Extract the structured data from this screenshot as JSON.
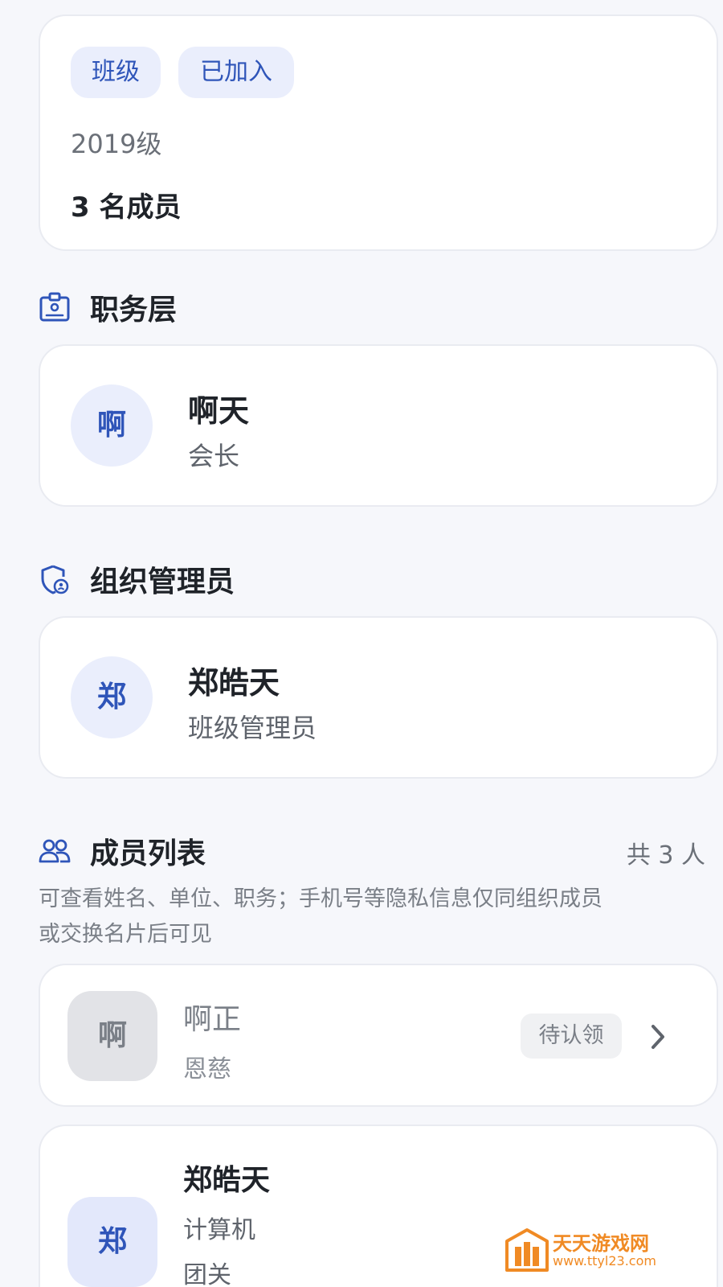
{
  "group_card": {
    "tag_type": "班级",
    "tag_status": "已加入",
    "grade": "2019级",
    "member_count": "3 名成员"
  },
  "sections": {
    "officers_title": "职务层",
    "admins_title": "组织管理员",
    "members_title": "成员列表"
  },
  "officer": {
    "avatar_char": "啊",
    "name": "啊天",
    "role": "会长"
  },
  "admin": {
    "avatar_char": "郑",
    "name": "郑皓天",
    "role": "班级管理员"
  },
  "members": {
    "total": "共 3 人",
    "note_line1": "可查看姓名、单位、职务；手机号等隐私信息仅同组织成员",
    "note_line2": "或交换名片后可见",
    "items": [
      {
        "avatar_char": "啊",
        "name": "啊正",
        "unit": "恩慈",
        "badge": "待认领"
      },
      {
        "avatar_char": "郑",
        "name": "郑皓天",
        "unit": "计算机",
        "role_partial": "团关"
      }
    ]
  },
  "watermark": {
    "brand": "天天游戏网",
    "url": "www.ttyl23.com"
  },
  "colors": {
    "accent": "#2f55b9",
    "tag_bg": "#eaeefc",
    "page_bg": "#f6f7fb",
    "pending_bg": "#f0f1f3"
  }
}
